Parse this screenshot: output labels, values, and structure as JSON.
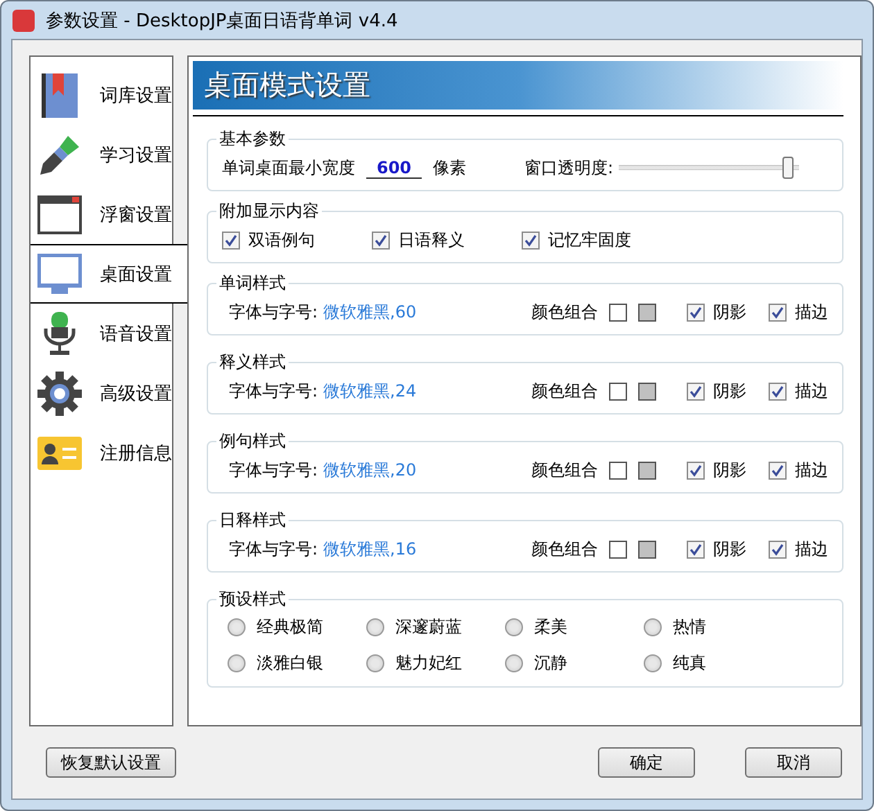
{
  "window": {
    "title": "参数设置 - DesktopJP桌面日语背单词 v4.4"
  },
  "sidebar": {
    "items": [
      {
        "label": "词库设置",
        "selected": false
      },
      {
        "label": "学习设置",
        "selected": false
      },
      {
        "label": "浮窗设置",
        "selected": false
      },
      {
        "label": "桌面设置",
        "selected": true
      },
      {
        "label": "语音设置",
        "selected": false
      },
      {
        "label": "高级设置",
        "selected": false
      },
      {
        "label": "注册信息",
        "selected": false
      }
    ]
  },
  "panel": {
    "title": "桌面模式设置"
  },
  "basic": {
    "legend": "基本参数",
    "width_label": "单词桌面最小宽度",
    "width_value": "600",
    "width_unit": "像素",
    "opacity_label": "窗口透明度:",
    "opacity_slider": {
      "level": 0.97
    }
  },
  "extra": {
    "legend": "附加显示内容",
    "options": [
      {
        "label": "双语例句",
        "checked": true
      },
      {
        "label": "日语释义",
        "checked": true
      },
      {
        "label": "记忆牢固度",
        "checked": true
      }
    ]
  },
  "styles": [
    {
      "legend": "单词样式",
      "font_label": "字体与字号:",
      "font_value": "微软雅黑,60",
      "color_label": "颜色组合",
      "colors": [
        {
          "color": "#ffffff"
        },
        {
          "color": "#c0c0c0"
        }
      ],
      "shadow": {
        "label": "阴影",
        "checked": true
      },
      "outline": {
        "label": "描边",
        "checked": true
      }
    },
    {
      "legend": "释义样式",
      "font_label": "字体与字号:",
      "font_value": "微软雅黑,24",
      "color_label": "颜色组合",
      "colors": [
        {
          "color": "#ffffff"
        },
        {
          "color": "#c0c0c0"
        }
      ],
      "shadow": {
        "label": "阴影",
        "checked": true
      },
      "outline": {
        "label": "描边",
        "checked": true
      }
    },
    {
      "legend": "例句样式",
      "font_label": "字体与字号:",
      "font_value": "微软雅黑,20",
      "color_label": "颜色组合",
      "colors": [
        {
          "color": "#ffffff"
        },
        {
          "color": "#c0c0c0"
        }
      ],
      "shadow": {
        "label": "阴影",
        "checked": true
      },
      "outline": {
        "label": "描边",
        "checked": true
      }
    },
    {
      "legend": "日释样式",
      "font_label": "字体与字号:",
      "font_value": "微软雅黑,16",
      "color_label": "颜色组合",
      "colors": [
        {
          "color": "#ffffff"
        },
        {
          "color": "#c0c0c0"
        }
      ],
      "shadow": {
        "label": "阴影",
        "checked": true
      },
      "outline": {
        "label": "描边",
        "checked": true
      }
    }
  ],
  "presets": {
    "legend": "预设样式",
    "options": [
      {
        "label": "经典极简",
        "selected": false
      },
      {
        "label": "深邃蔚蓝",
        "selected": false
      },
      {
        "label": "柔美",
        "selected": false
      },
      {
        "label": "热情",
        "selected": false
      },
      {
        "label": "淡雅白银",
        "selected": false
      },
      {
        "label": "魅力妃红",
        "selected": false
      },
      {
        "label": "沉静",
        "selected": false
      },
      {
        "label": "纯真",
        "selected": false
      }
    ]
  },
  "buttons": {
    "reset": "恢复默认设置",
    "ok": "确定",
    "cancel": "取消"
  }
}
